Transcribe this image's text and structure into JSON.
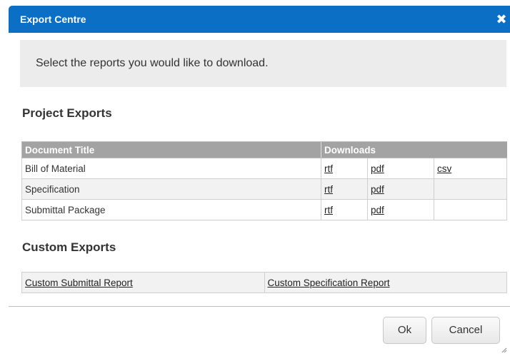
{
  "dialog": {
    "title": "Export Centre",
    "close_glyph": "✖",
    "instruction": "Select the reports you would like to download."
  },
  "project_exports": {
    "heading": "Project Exports",
    "columns": [
      "Document Title",
      "Downloads"
    ],
    "rows": [
      {
        "title": "Bill of Material",
        "formats": [
          "rtf",
          "pdf",
          "csv"
        ]
      },
      {
        "title": "Specification",
        "formats": [
          "rtf",
          "pdf",
          ""
        ]
      },
      {
        "title": "Submittal Package",
        "formats": [
          "rtf",
          "pdf",
          ""
        ]
      }
    ]
  },
  "custom_exports": {
    "heading": "Custom Exports",
    "links": [
      "Custom Submittal Report",
      "Custom Specification Report"
    ]
  },
  "buttons": {
    "ok": "Ok",
    "cancel": "Cancel"
  },
  "colors": {
    "titlebar": "#0b6fc6",
    "header_row": "#a3a3a3",
    "panel": "#ececec"
  },
  "icons": {
    "close": "close-icon",
    "resize": "resize-grip-icon"
  }
}
